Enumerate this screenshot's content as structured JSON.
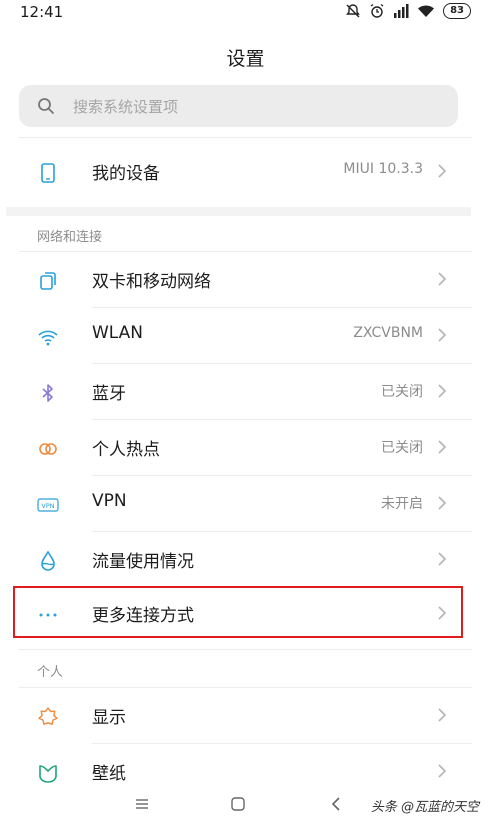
{
  "status_bar": {
    "time": "12:41",
    "battery": "83",
    "icons": [
      "mute-icon",
      "alarm-icon",
      "signal-icon",
      "wifi-icon",
      "battery-icon"
    ]
  },
  "header": {
    "title": "设置"
  },
  "search": {
    "placeholder": "搜索系统设置项"
  },
  "device": {
    "label": "我的设备",
    "value": "MIUI 10.3.3",
    "icon": "phone-icon"
  },
  "sections": {
    "network": "网络和连接",
    "personal": "个人"
  },
  "network_items": [
    {
      "label": "双卡和移动网络",
      "value": "",
      "icon": "dual-sim-icon"
    },
    {
      "label": "WLAN",
      "value": "ZXCVBNM",
      "icon": "wifi-icon"
    },
    {
      "label": "蓝牙",
      "value": "已关闭",
      "icon": "bluetooth-icon"
    },
    {
      "label": "个人热点",
      "value": "已关闭",
      "icon": "hotspot-icon"
    },
    {
      "label": "VPN",
      "value": "未开启",
      "icon": "vpn-icon"
    },
    {
      "label": "流量使用情况",
      "value": "",
      "icon": "data-usage-icon"
    },
    {
      "label": "更多连接方式",
      "value": "",
      "icon": "more-icon"
    }
  ],
  "personal_items": [
    {
      "label": "显示",
      "value": "",
      "icon": "display-icon"
    },
    {
      "label": "壁纸",
      "value": "",
      "icon": "wallpaper-icon"
    }
  ],
  "vpn_badge": "VPN",
  "watermark": "头条 @瓦蓝的天空",
  "colors": {
    "highlight": "#e01d1d",
    "accent_blue": "#2aa0d8",
    "bluetooth_purple": "#8a7ad8",
    "hotspot_orange": "#f08a3c",
    "display_orange": "#f08a3c",
    "wallpaper_green": "#21a57a"
  }
}
